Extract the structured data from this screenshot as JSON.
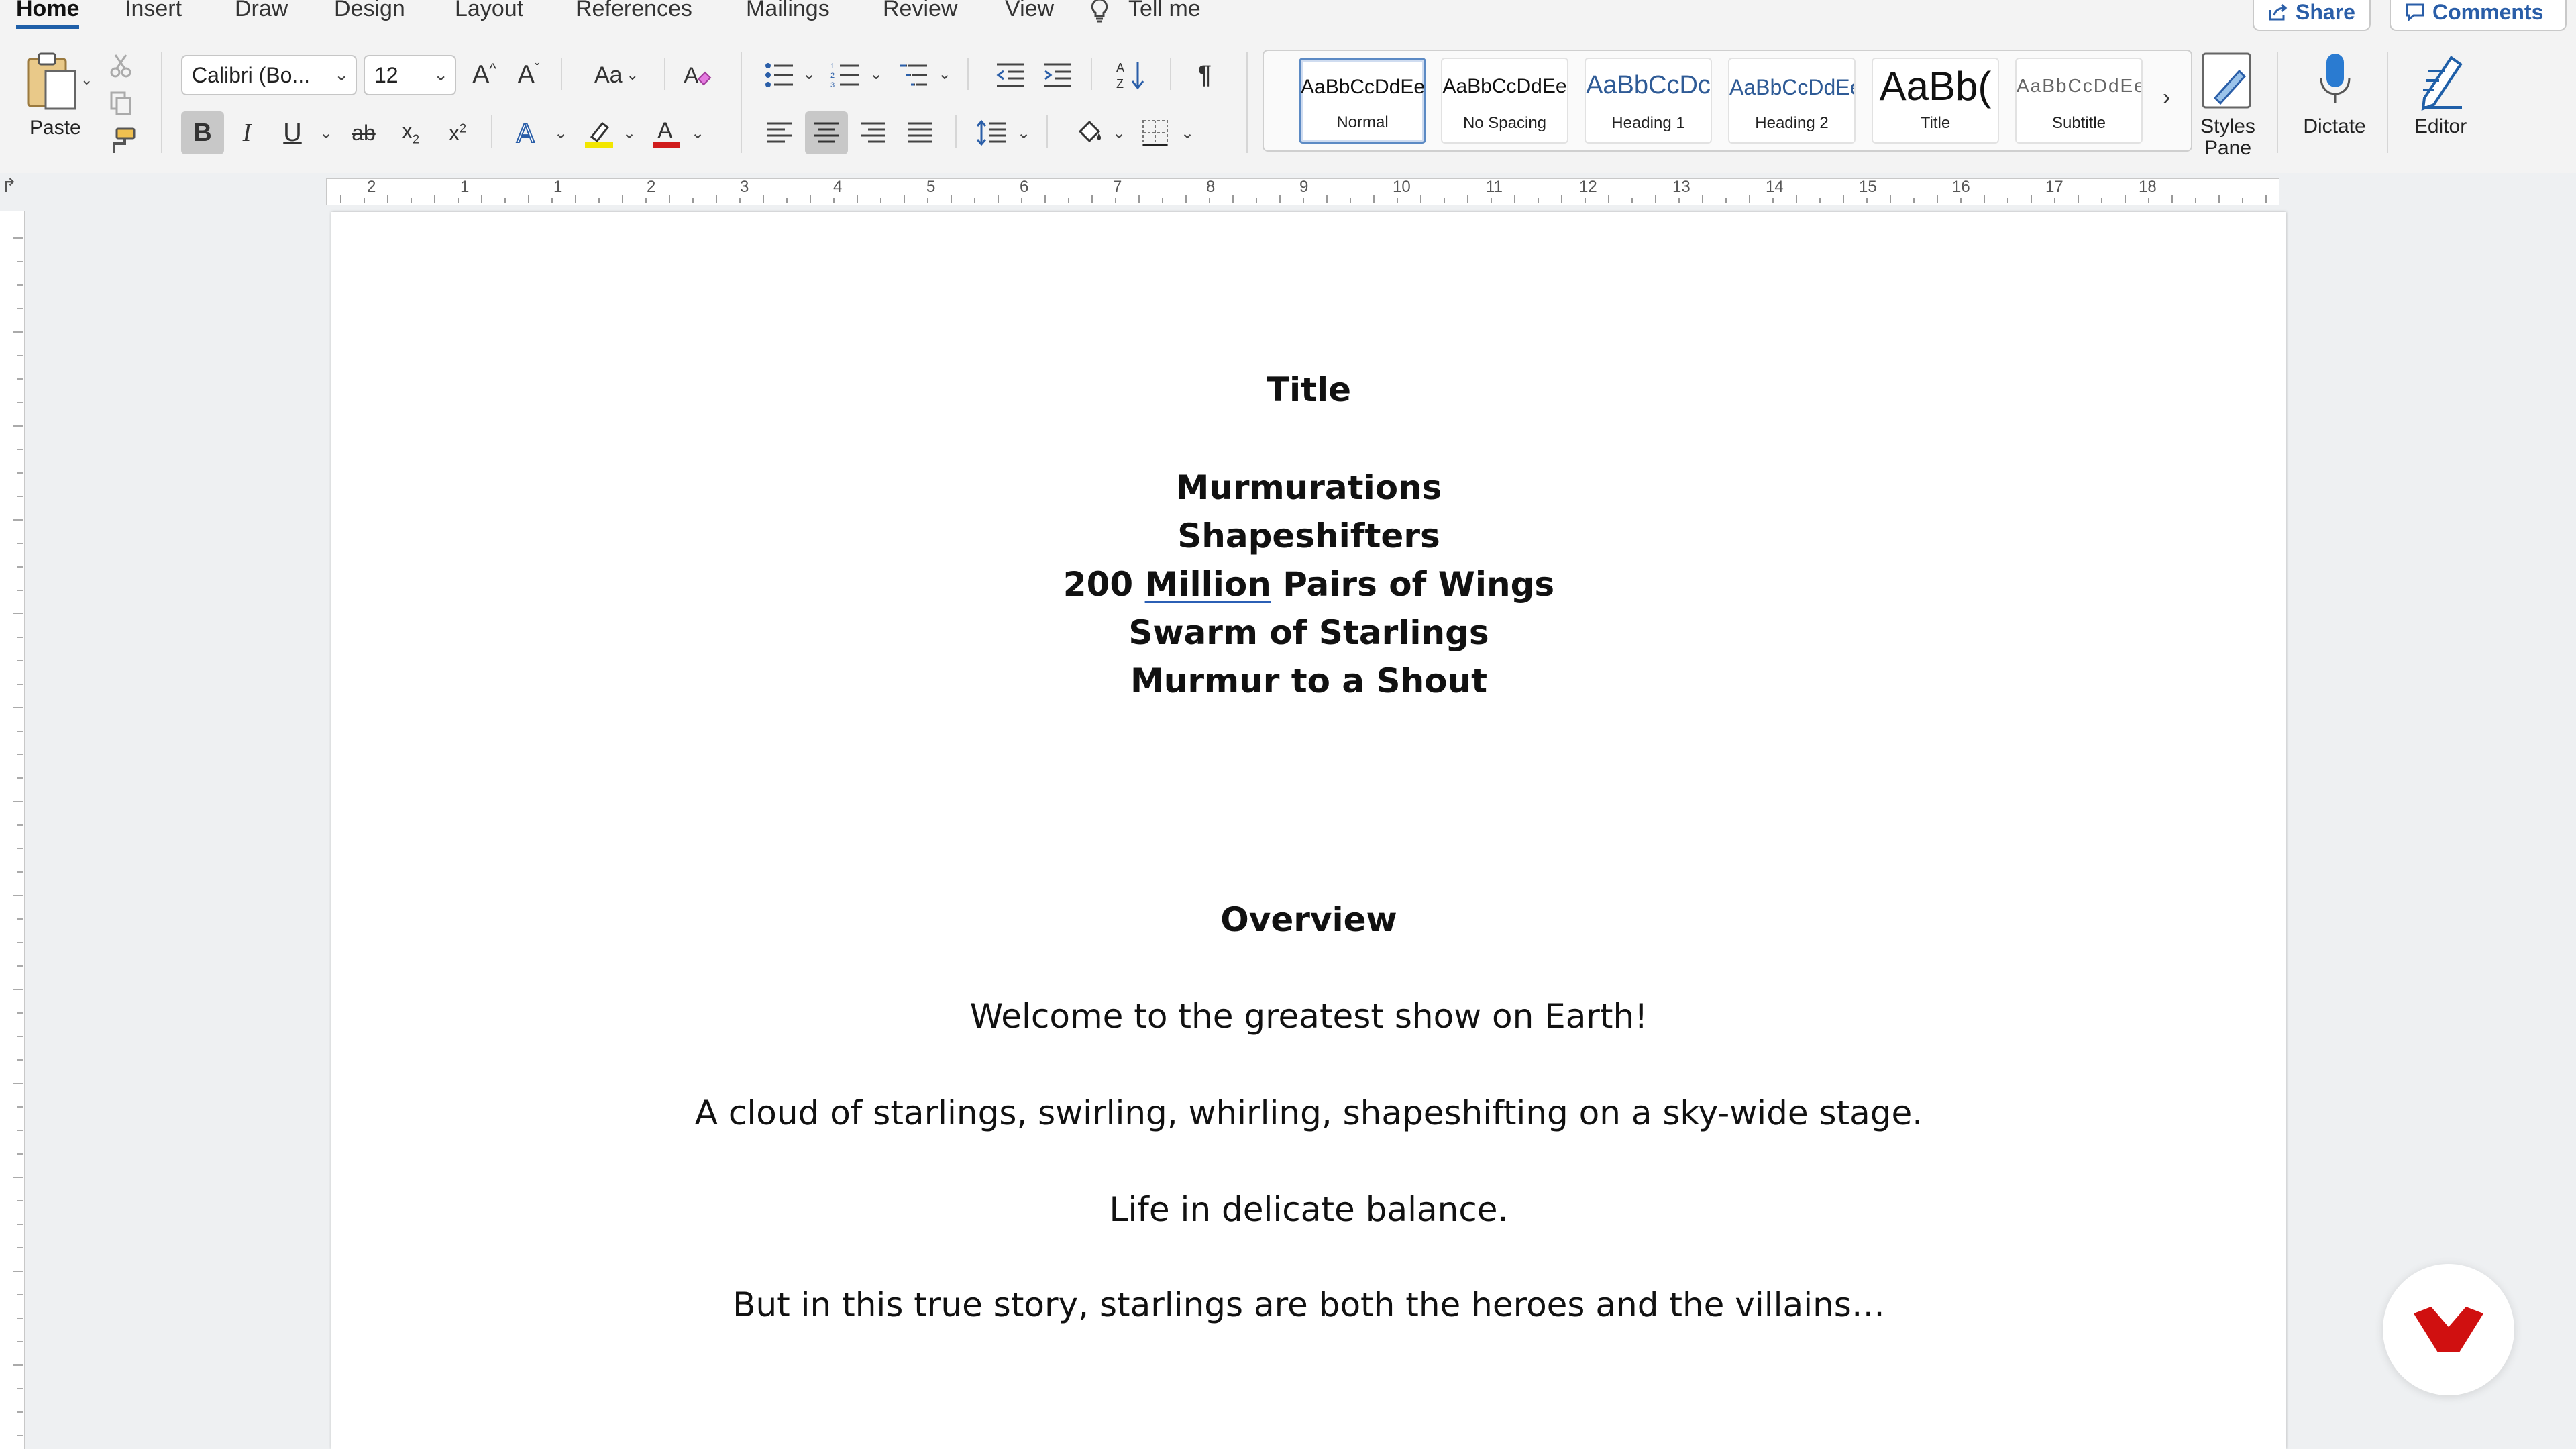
{
  "menu": {
    "tabs": [
      "Home",
      "Insert",
      "Draw",
      "Design",
      "Layout",
      "References",
      "Mailings",
      "Review",
      "View"
    ],
    "tell_me": "Tell me",
    "share": "Share",
    "comments": "Comments"
  },
  "clipboard": {
    "paste_label": "Paste"
  },
  "font": {
    "name": "Calibri (Bo...",
    "size": "12",
    "case_label": "Aa"
  },
  "styles": {
    "tiles": [
      {
        "sample": "AaBbCcDdEe",
        "name": "Normal"
      },
      {
        "sample": "AaBbCcDdEe",
        "name": "No Spacing"
      },
      {
        "sample": "AaBbCcDc",
        "name": "Heading 1"
      },
      {
        "sample": "AaBbCcDdEe",
        "name": "Heading 2"
      },
      {
        "sample": "AaBb(",
        "name": "Title"
      },
      {
        "sample": "AaBbCcDdEe",
        "name": "Subtitle"
      }
    ],
    "selected": "Normal",
    "styles_pane_label_1": "Styles",
    "styles_pane_label_2": "Pane"
  },
  "dictate_label": "Dictate",
  "editor_label": "Editor",
  "ruler": {
    "numbers": [
      "2",
      "1",
      "1",
      "2",
      "3",
      "4",
      "5",
      "6",
      "7",
      "8",
      "9",
      "10",
      "11",
      "12",
      "13",
      "14",
      "15",
      "16",
      "17",
      "18"
    ]
  },
  "document": {
    "title_heading": "Title",
    "titles": {
      "line1": "Murmurations",
      "line2": "Shapeshifters",
      "line3_prefix": "200 ",
      "line3_underlined": "Million",
      "line3_suffix": " Pairs of Wings",
      "line4": "Swarm of Starlings",
      "line5": "Murmur to a Shout"
    },
    "overview_heading": "Overview",
    "paragraphs": [
      "Welcome to the greatest show on Earth!",
      "A cloud of starlings, swirling, whirling, shapeshifting on a sky-wide stage.",
      "Life in delicate balance.",
      "But in this true story, starlings are both the heroes and the villains…"
    ]
  },
  "colors": {
    "accent": "#1f5fa8",
    "highlight": "#f2e600",
    "font_color": "#d01c1c",
    "badge": "#d01010"
  }
}
